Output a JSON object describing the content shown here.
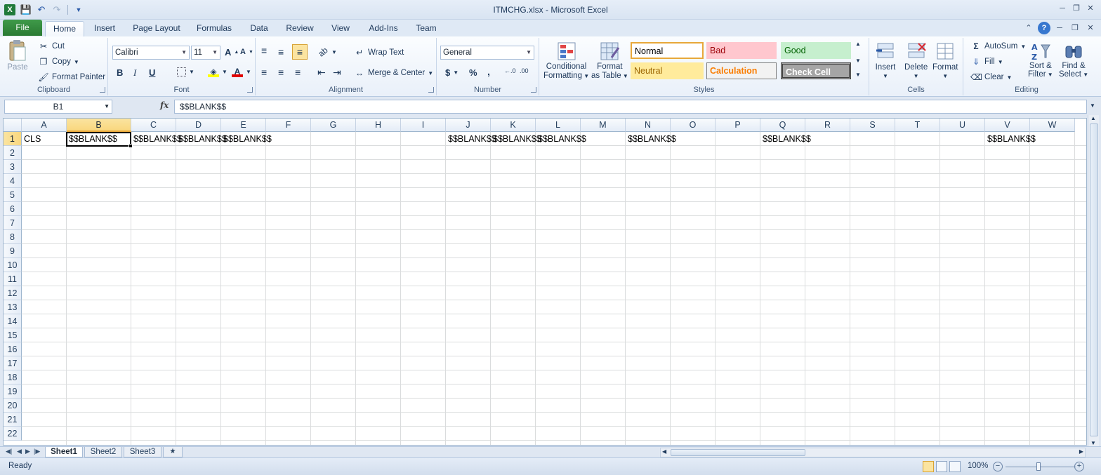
{
  "window": {
    "title": "ITMCHG.xlsx - Microsoft Excel",
    "logo": "X"
  },
  "qat": {
    "save_icon": "save-icon",
    "undo_icon": "undo-icon",
    "redo_icon": "redo-icon"
  },
  "tabs": [
    "File",
    "Home",
    "Insert",
    "Page Layout",
    "Formulas",
    "Data",
    "Review",
    "View",
    "Add-Ins",
    "Team"
  ],
  "ribbon": {
    "clipboard": {
      "label": "Clipboard",
      "paste": "Paste",
      "cut": "Cut",
      "copy": "Copy",
      "format_painter": "Format Painter"
    },
    "font": {
      "label": "Font",
      "name": "Calibri",
      "size": "11",
      "bold": "B",
      "italic": "I",
      "underline": "U",
      "font_color": "A"
    },
    "alignment": {
      "label": "Alignment",
      "wrap": "Wrap Text",
      "merge": "Merge & Center"
    },
    "number": {
      "label": "Number",
      "format": "General",
      "currency": "$",
      "percent": "%",
      "comma": ","
    },
    "styles": {
      "label": "Styles",
      "conditional": "Conditional",
      "conditional2": "Formatting",
      "format_table": "Format",
      "format_table2": "as Table",
      "items": [
        {
          "name": "Normal",
          "bg": "#ffffff",
          "fg": "#000000",
          "border": "#e8a83a"
        },
        {
          "name": "Bad",
          "bg": "#ffc7ce",
          "fg": "#9c0006",
          "border": "#ffc7ce"
        },
        {
          "name": "Good",
          "bg": "#c6efce",
          "fg": "#006100",
          "border": "#c6efce"
        },
        {
          "name": "Neutral",
          "bg": "#ffeb9c",
          "fg": "#9c6500",
          "border": "#ffeb9c"
        },
        {
          "name": "Calculation",
          "bg": "#f2f2f2",
          "fg": "#fa7d00",
          "border": "#7f7f7f"
        },
        {
          "name": "Check Cell",
          "bg": "#a5a5a5",
          "fg": "#ffffff",
          "border": "#3f3f3f"
        }
      ]
    },
    "cells": {
      "label": "Cells",
      "insert": "Insert",
      "delete": "Delete",
      "format": "Format"
    },
    "editing": {
      "label": "Editing",
      "autosum": "AutoSum",
      "fill": "Fill",
      "clear": "Clear",
      "sort": "Sort &",
      "sort2": "Filter",
      "find": "Find &",
      "find2": "Select"
    }
  },
  "formula_bar": {
    "name_box": "B1",
    "fx": "fx",
    "value": "$$BLANK$$"
  },
  "grid": {
    "columns": [
      "A",
      "B",
      "C",
      "D",
      "E",
      "F",
      "G",
      "H",
      "I",
      "J",
      "K",
      "L",
      "M",
      "N",
      "O",
      "P",
      "Q",
      "R",
      "S",
      "T",
      "U",
      "V",
      "W"
    ],
    "rows": [
      "1",
      "2",
      "3",
      "4",
      "5",
      "6",
      "7",
      "8",
      "9",
      "10",
      "11",
      "12",
      "13",
      "14",
      "15",
      "16",
      "17",
      "18",
      "19",
      "20",
      "21",
      "22"
    ],
    "selected_column": "B",
    "selected_row": "1",
    "row1": {
      "A": "CLS",
      "B": "$$BLANK$$",
      "C": "$$BLANK$$",
      "D": "$$BLANK$$",
      "E": "$$BLANK$$",
      "J": "$$BLANK$$",
      "K": "$$BLANK$$",
      "L": "$$BLANK$$",
      "N": "$$BLANK$$",
      "Q": "$$BLANK$$",
      "V": "$$BLANK$$"
    }
  },
  "sheets": [
    "Sheet1",
    "Sheet2",
    "Sheet3"
  ],
  "active_sheet": "Sheet1",
  "status": {
    "text": "Ready",
    "zoom": "100%"
  }
}
